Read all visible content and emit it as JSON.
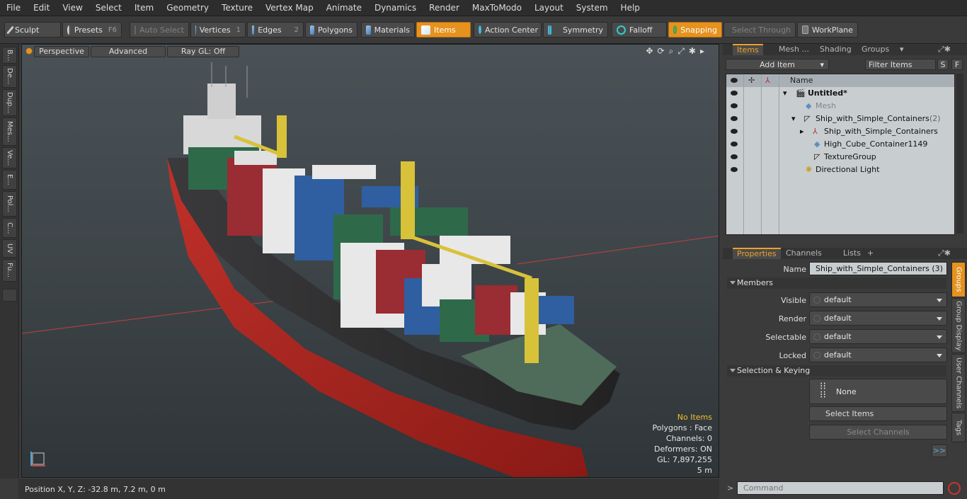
{
  "menu": [
    "File",
    "Edit",
    "View",
    "Select",
    "Item",
    "Geometry",
    "Texture",
    "Vertex Map",
    "Animate",
    "Dynamics",
    "Render",
    "MaxToModo",
    "Layout",
    "System",
    "Help"
  ],
  "toolbar": {
    "sculpt": "Sculpt",
    "presets": "Presets",
    "presets_key": "F6",
    "auto_select": "Auto Select",
    "vertices": "Vertices",
    "vertices_key": "1",
    "edges": "Edges",
    "edges_key": "2",
    "polygons": "Polygons",
    "materials": "Materials",
    "items": "Items",
    "action_center": "Action Center",
    "symmetry": "Symmetry",
    "falloff": "Falloff",
    "snapping": "Snapping",
    "select_through": "Select Through",
    "workplane": "WorkPlane"
  },
  "left_tabs": [
    "B...",
    "De...",
    "Dup...",
    "Mes...",
    "Ve...",
    "E...",
    "Pol...",
    "C...",
    "UV",
    "Fu..."
  ],
  "viewport": {
    "perspective": "Perspective",
    "advanced": "Advanced",
    "raygl": "Ray GL: Off",
    "info": {
      "items": "No Items",
      "polygons": "Polygons : Face",
      "channels": "Channels: 0",
      "deformers": "Deformers: ON",
      "gl": "GL: 7,897,255",
      "scale": "5 m"
    }
  },
  "status": {
    "position": "Position X, Y, Z:   -32.8 m, 7.2 m, 0 m"
  },
  "items_panel": {
    "tabs": [
      "Items",
      "Mesh ...",
      "Shading",
      "Groups"
    ],
    "add_item": "Add Item",
    "filter_items": "Filter Items",
    "s_btn": "S",
    "f_btn": "F",
    "name_header": "Name",
    "rows": [
      {
        "label": "Untitled*",
        "count": ""
      },
      {
        "label": "Mesh",
        "count": ""
      },
      {
        "label": "Ship_with_Simple_Containers",
        "count": "(2)"
      },
      {
        "label": "Ship_with_Simple_Containers",
        "count": ""
      },
      {
        "label": "High_Cube_Container1149",
        "count": ""
      },
      {
        "label": "TextureGroup",
        "count": ""
      },
      {
        "label": "Directional Light",
        "count": ""
      }
    ]
  },
  "properties_panel": {
    "tabs": [
      "Properties",
      "Channels",
      "Lists",
      "+"
    ],
    "name_label": "Name",
    "name_value": "Ship_with_Simple_Containers (3)",
    "members": "Members",
    "visible_label": "Visible",
    "visible_value": "default",
    "render_label": "Render",
    "render_value": "default",
    "selectable_label": "Selectable",
    "selectable_value": "default",
    "locked_label": "Locked",
    "locked_value": "default",
    "selection_keying": "Selection & Keying",
    "none": "None",
    "select_items": "Select Items",
    "select_channels": "Select Channels",
    "more": ">>",
    "side_tabs": [
      "Groups",
      "Group Display",
      "User Channels",
      "Tags"
    ]
  },
  "command": {
    "placeholder": "Command",
    "prompt": ">"
  }
}
